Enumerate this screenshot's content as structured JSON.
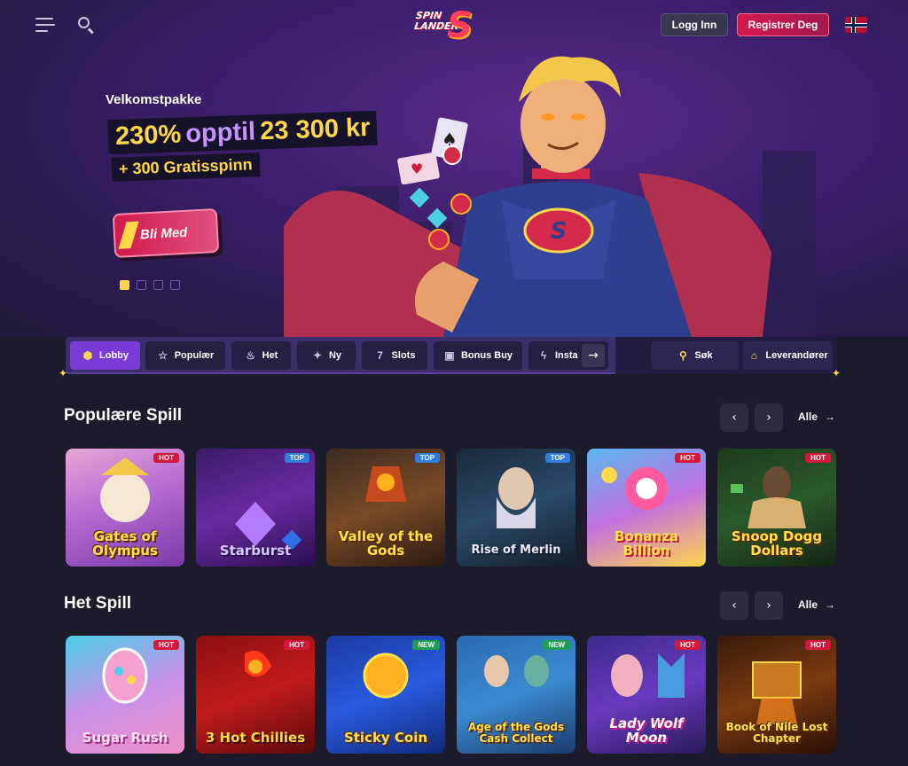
{
  "header": {
    "login_label": "Logg Inn",
    "register_label": "Registrer Deg",
    "logo_text": "SPIN LANDER",
    "language_flag": "norway-flag"
  },
  "hero": {
    "subtitle": "Velkomstpakke",
    "percent": "230%",
    "amount_text": "opptil",
    "amount_value": "23 300 kr",
    "spins": "+ 300 Gratisspinn",
    "cta_label": "Bli Med",
    "slides_total": 4,
    "active_slide": 1
  },
  "nav": {
    "tabs": [
      {
        "label": "Lobby",
        "icon": "lobby-icon"
      },
      {
        "label": "Populær",
        "icon": "star-icon"
      },
      {
        "label": "Het",
        "icon": "flame-icon"
      },
      {
        "label": "Ny",
        "icon": "sparkle-icon"
      },
      {
        "label": "Slots",
        "icon": "slot-icon"
      },
      {
        "label": "Bonus Buy",
        "icon": "gift-icon"
      },
      {
        "label": "Insta",
        "icon": "lightning-icon"
      }
    ],
    "search_label": "Søk",
    "providers_label": "Leverandører"
  },
  "popular": {
    "title": "Populære Spill",
    "all_label": "Alle",
    "games": [
      {
        "name": "Gates of Olympus",
        "badge": "HOT"
      },
      {
        "name": "Starburst",
        "badge": "TOP"
      },
      {
        "name": "Valley of the Gods",
        "badge": "TOP"
      },
      {
        "name": "Rise of Merlin",
        "badge": "TOP"
      },
      {
        "name": "Bonanza Billion",
        "badge": "HOT"
      },
      {
        "name": "Snoop Dogg Dollars",
        "badge": "HOT"
      }
    ]
  },
  "hot": {
    "title": "Het Spill",
    "all_label": "Alle",
    "games": [
      {
        "name": "Sugar Rush",
        "badge": "HOT"
      },
      {
        "name": "3 Hot Chillies",
        "badge": "HOT"
      },
      {
        "name": "Sticky Coin",
        "badge": "NEW"
      },
      {
        "name": "Age of the Gods Cash Collect",
        "badge": "NEW"
      },
      {
        "name": "Lady Wolf Moon",
        "badge": "HOT"
      },
      {
        "name": "Book of Nile Lost Chapter",
        "badge": "HOT"
      }
    ]
  },
  "colors": {
    "background": "#1c1b2b",
    "accent_purple": "#7a3ad6",
    "accent_red": "#d4194e",
    "accent_yellow": "#ffd84a"
  }
}
